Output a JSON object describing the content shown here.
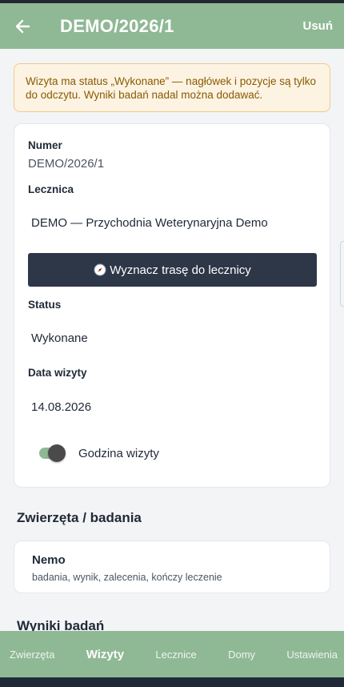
{
  "header": {
    "title": "DEMO/2026/1",
    "action_label": "Usuń"
  },
  "banner": {
    "text": "Wizyta ma status „Wykonane” — nagłówek i pozycje są tylko do odczytu. Wyniki badań nadal można dodawać."
  },
  "visit": {
    "number_label": "Numer",
    "number_value": "DEMO/2026/1",
    "clinic_label": "Lecznica",
    "clinic_value": "DEMO — Przychodnia Weterynaryjna Demo",
    "route_button_label": "Wyznacz trasę do lecznicy",
    "status_label": "Status",
    "status_value": "Wykonane",
    "date_label": "Data wizyty",
    "date_value": "14.08.2026",
    "time_toggle_label": "Godzina wizyty"
  },
  "animals_section": {
    "title": "Zwierzęta / badania",
    "items": [
      {
        "name": "Nemo",
        "subtitle": "badania, wynik, zalecenia, kończy leczenie"
      }
    ]
  },
  "results_section": {
    "title": "Wyniki badań"
  },
  "bottom_nav": {
    "items": [
      {
        "label": "Zwierzęta"
      },
      {
        "label": "Wizyty"
      },
      {
        "label": "Lecznice"
      },
      {
        "label": "Domy"
      },
      {
        "label": "Ustawienia"
      }
    ]
  },
  "colors": {
    "primary": "#8fb894",
    "dark_button": "#2d3748",
    "banner_bg": "#fdf3e3",
    "banner_text": "#8a5a00"
  }
}
